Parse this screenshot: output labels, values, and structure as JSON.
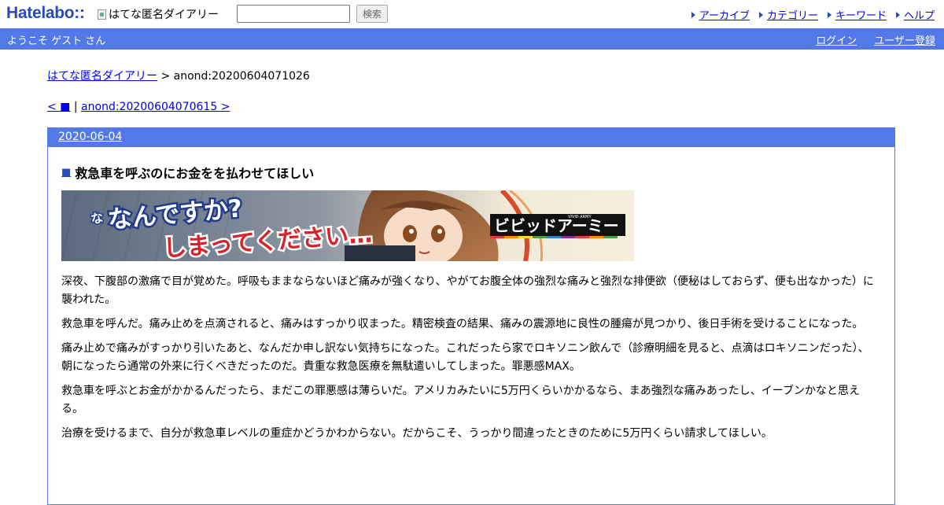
{
  "header": {
    "logo": "Hatelabo::",
    "diary_logo_alt": "はてな匿名ダイアリー",
    "search": {
      "value": "",
      "button_label": "検索"
    },
    "nav": [
      {
        "label": "アーカイブ"
      },
      {
        "label": "カテゴリー"
      },
      {
        "label": "キーワード"
      },
      {
        "label": "ヘルプ"
      }
    ]
  },
  "welcome": {
    "text": "ようこそ ゲスト さん",
    "login": "ログイン",
    "register": "ユーザー登録"
  },
  "breadcrumb": {
    "root": "はてな匿名ダイアリー",
    "separator": ">",
    "current": "anond:20200604071026"
  },
  "pager": {
    "prev": "< ■",
    "separator": "|",
    "next": "anond:20200604070615 >"
  },
  "entry": {
    "date": "2020-06-04",
    "square": "■",
    "title": "救急車を呼ぶのにお金をを払わせてほしい",
    "paragraphs": [
      "深夜、下腹部の激痛で目が覚めた。呼吸もままならないほど痛みが強くなり、やがてお腹全体の強烈な痛みと強烈な排便欲（便秘はしておらず、便も出なかった）に襲われた。",
      "救急車を呼んだ。痛み止めを点滴されると、痛みはすっかり収まった。精密検査の結果、痛みの震源地に良性の腫瘍が見つかり、後日手術を受けることになった。",
      "痛み止めで痛みがすっかり引いたあと、なんだか申し訳ない気持ちになった。これだったら家でロキソニン飲んで（診療明細を見ると、点滴はロキソニンだった）、朝になったら通常の外来に行くべきだったのだ。貴重な救急医療を無駄遣いしてしまった。罪悪感MAX。",
      "救急車を呼ぶとお金がかかるんだったら、まだこの罪悪感は薄らいだ。アメリカみたいに5万円くらいかかるなら、まあ強烈な痛みあったし、イーブンかなと思える。",
      "治療を受けるまで、自分が救急車レベルの重症かどうかわからない。だからこそ、うっかり間違ったときのために5万円くらい請求してほしい。"
    ]
  },
  "banner": {
    "line1_small": "な",
    "line1": "なんですか?",
    "line2": "しまってください…",
    "brand": "ビビッドアーミー",
    "brand_small": "VIVID ARMY"
  }
}
